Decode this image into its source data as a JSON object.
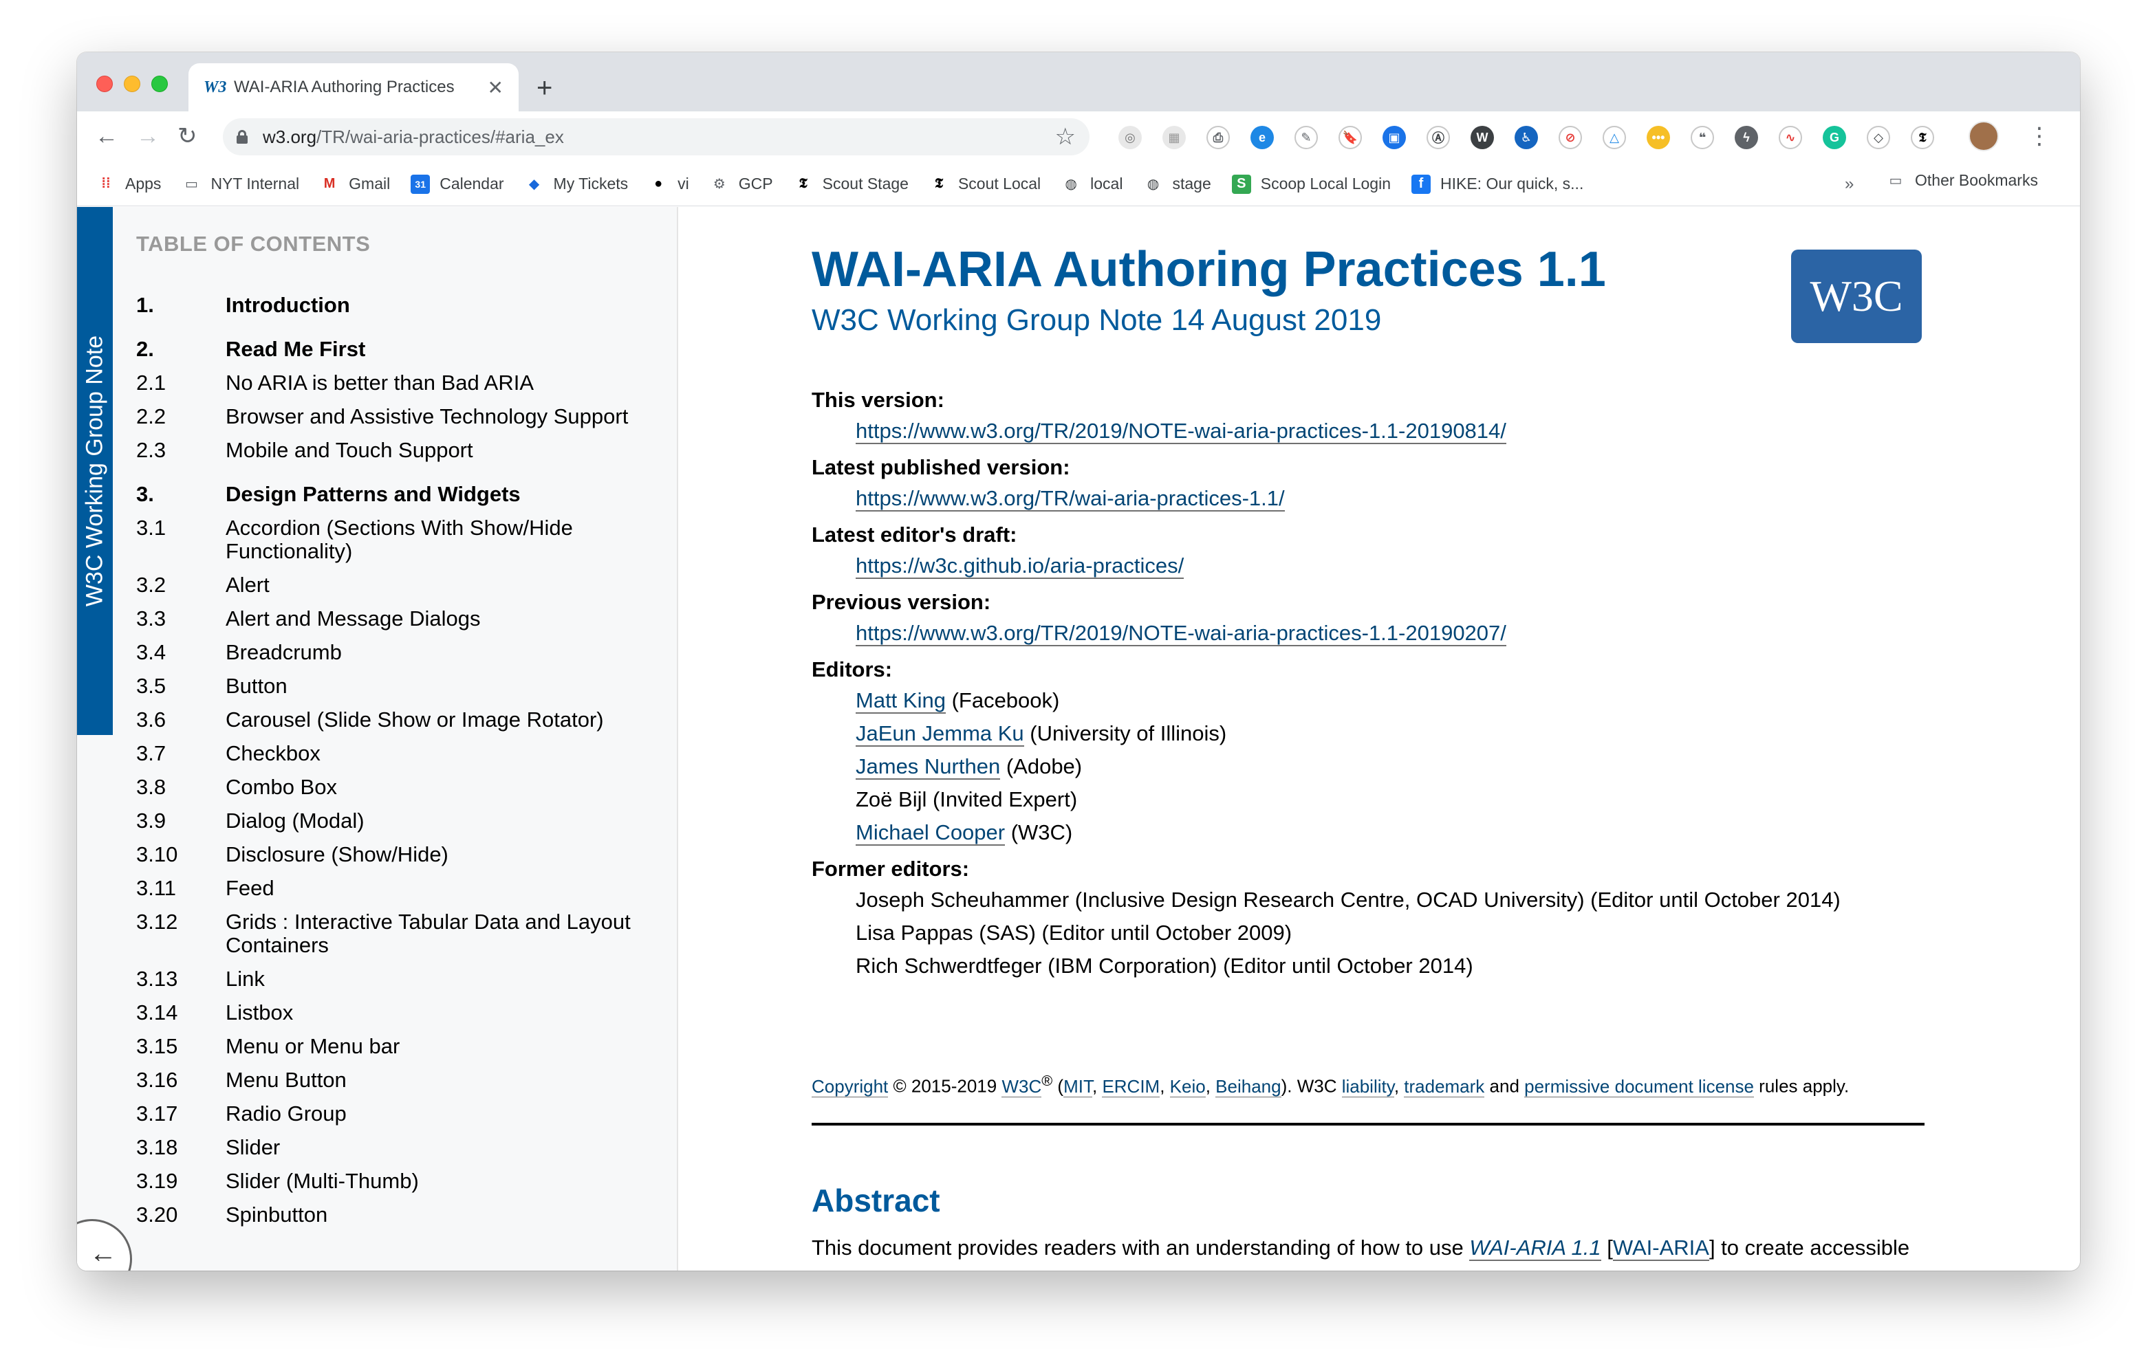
{
  "browser": {
    "tab_title": "WAI-ARIA Authoring Practices",
    "tab_favicon": "W3",
    "close_glyph": "✕",
    "new_tab_glyph": "+",
    "url_host": "w3.org",
    "url_path": "/TR/wai-aria-practices/#aria_ex",
    "back_glyph": "←",
    "forward_glyph": "→",
    "reload_glyph": "↻",
    "star_glyph": "☆",
    "menu_glyph": "⋮",
    "extensions": [
      "color-picker-icon",
      "screenshot-icon",
      "printer-icon",
      "ie-tab-icon",
      "eyedropper-icon",
      "bookmark-icon",
      "window-icon",
      "accessibility-a-icon",
      "wordpress-icon",
      "accessibility-person-icon",
      "no-script-icon",
      "warning-icon",
      "note-icon",
      "speech-icon",
      "bolt-icon",
      "chart-icon",
      "grammarly-icon",
      "pocket-icon",
      "nyt-icon"
    ]
  },
  "bookmarks": {
    "items": [
      {
        "label": "Apps",
        "icon": "apps-grid-icon"
      },
      {
        "label": "NYT Internal",
        "icon": "folder-icon"
      },
      {
        "label": "Gmail",
        "icon": "gmail-icon"
      },
      {
        "label": "Calendar",
        "icon": "calendar-icon"
      },
      {
        "label": "My Tickets",
        "icon": "jira-icon"
      },
      {
        "label": "vi",
        "icon": "github-icon"
      },
      {
        "label": "GCP",
        "icon": "gcp-icon"
      },
      {
        "label": "Scout Stage",
        "icon": "nyt-t-icon"
      },
      {
        "label": "Scout Local",
        "icon": "nyt-t-icon"
      },
      {
        "label": "local",
        "icon": "globe-icon"
      },
      {
        "label": "stage",
        "icon": "globe-icon"
      },
      {
        "label": "Scoop Local Login",
        "icon": "scoop-icon"
      },
      {
        "label": "HIKE: Our quick, s...",
        "icon": "facebook-icon"
      }
    ],
    "overflow": "»",
    "other_label": "Other Bookmarks"
  },
  "sidebar": {
    "logo_text": "W3C Working Group Note",
    "toc_heading": "TABLE OF CONTENTS",
    "back_glyph": "←",
    "toc": [
      {
        "num": "1.",
        "label": "Introduction",
        "major": true
      },
      {
        "num": "2.",
        "label": "Read Me First",
        "major": true
      },
      {
        "num": "2.1",
        "label": "No ARIA is better than Bad ARIA",
        "major": false
      },
      {
        "num": "2.2",
        "label": "Browser and Assistive Technology Support",
        "major": false
      },
      {
        "num": "2.3",
        "label": "Mobile and Touch Support",
        "major": false
      },
      {
        "num": "3.",
        "label": "Design Patterns and Widgets",
        "major": true
      },
      {
        "num": "3.1",
        "label": "Accordion (Sections With Show/Hide Functionality)",
        "major": false
      },
      {
        "num": "3.2",
        "label": "Alert",
        "major": false
      },
      {
        "num": "3.3",
        "label": "Alert and Message Dialogs",
        "major": false
      },
      {
        "num": "3.4",
        "label": "Breadcrumb",
        "major": false
      },
      {
        "num": "3.5",
        "label": "Button",
        "major": false
      },
      {
        "num": "3.6",
        "label": "Carousel (Slide Show or Image Rotator)",
        "major": false
      },
      {
        "num": "3.7",
        "label": "Checkbox",
        "major": false
      },
      {
        "num": "3.8",
        "label": "Combo Box",
        "major": false
      },
      {
        "num": "3.9",
        "label": "Dialog (Modal)",
        "major": false
      },
      {
        "num": "3.10",
        "label": "Disclosure (Show/Hide)",
        "major": false
      },
      {
        "num": "3.11",
        "label": "Feed",
        "major": false
      },
      {
        "num": "3.12",
        "label": "Grids : Interactive Tabular Data and Layout Containers",
        "major": false
      },
      {
        "num": "3.13",
        "label": "Link",
        "major": false
      },
      {
        "num": "3.14",
        "label": "Listbox",
        "major": false
      },
      {
        "num": "3.15",
        "label": "Menu or Menu bar",
        "major": false
      },
      {
        "num": "3.16",
        "label": "Menu Button",
        "major": false
      },
      {
        "num": "3.17",
        "label": "Radio Group",
        "major": false
      },
      {
        "num": "3.18",
        "label": "Slider",
        "major": false
      },
      {
        "num": "3.19",
        "label": "Slider (Multi-Thumb)",
        "major": false
      },
      {
        "num": "3.20",
        "label": "Spinbutton",
        "major": false
      }
    ]
  },
  "main": {
    "title": "WAI-ARIA Authoring Practices 1.1",
    "subtitle": "W3C Working Group Note 14 August 2019",
    "logo": "W3C",
    "this_version_label": "This version:",
    "this_version_url": "https://www.w3.org/TR/2019/NOTE-wai-aria-practices-1.1-20190814/",
    "latest_published_label": "Latest published version:",
    "latest_published_url": "https://www.w3.org/TR/wai-aria-practices-1.1/",
    "editors_draft_label": "Latest editor's draft:",
    "editors_draft_url": "https://w3c.github.io/aria-practices/",
    "previous_version_label": "Previous version:",
    "previous_version_url": "https://www.w3.org/TR/2019/NOTE-wai-aria-practices-1.1-20190207/",
    "editors_label": "Editors:",
    "editors": [
      {
        "name": "Matt King",
        "affiliation": " (Facebook)",
        "linked": true
      },
      {
        "name": "JaEun Jemma Ku",
        "affiliation": " (University of Illinois)",
        "linked": true
      },
      {
        "name": "James Nurthen",
        "affiliation": " (Adobe)",
        "linked": true
      },
      {
        "name": "Zoë Bijl",
        "affiliation": " (Invited Expert)",
        "linked": false
      },
      {
        "name": "Michael Cooper",
        "affiliation": " (W3C)",
        "linked": true
      }
    ],
    "former_editors_label": "Former editors:",
    "former_editors": [
      "Joseph Scheuhammer (Inclusive Design Research Centre, OCAD University) (Editor until October 2014)",
      "Lisa Pappas (SAS) (Editor until October 2009)",
      "Rich Schwerdtfeger (IBM Corporation) (Editor until October 2014)"
    ],
    "copyright": {
      "copyright_link": "Copyright",
      "years": " © 2015-2019 ",
      "w3c_link": "W3C",
      "reg": "®",
      "open_paren": " (",
      "mit": "MIT",
      "ercim": "ERCIM",
      "keio": "Keio",
      "beihang": "Beihang",
      "sep": ", ",
      "close": "). W3C ",
      "liability": "liability",
      "comma_space": ", ",
      "trademark": "trademark",
      "and": " and ",
      "license": "permissive document license",
      "rules": " rules apply."
    },
    "abstract_heading": "Abstract",
    "abstract_p1": "This document provides readers with an understanding of how to use ",
    "abstract_link": "WAI-ARIA 1.1",
    "abstract_ref_open": " [",
    "abstract_ref": "WAI-ARIA",
    "abstract_p2": "] to create accessible rich internet applications. It describes considerations that might not be evident to most authors from"
  }
}
